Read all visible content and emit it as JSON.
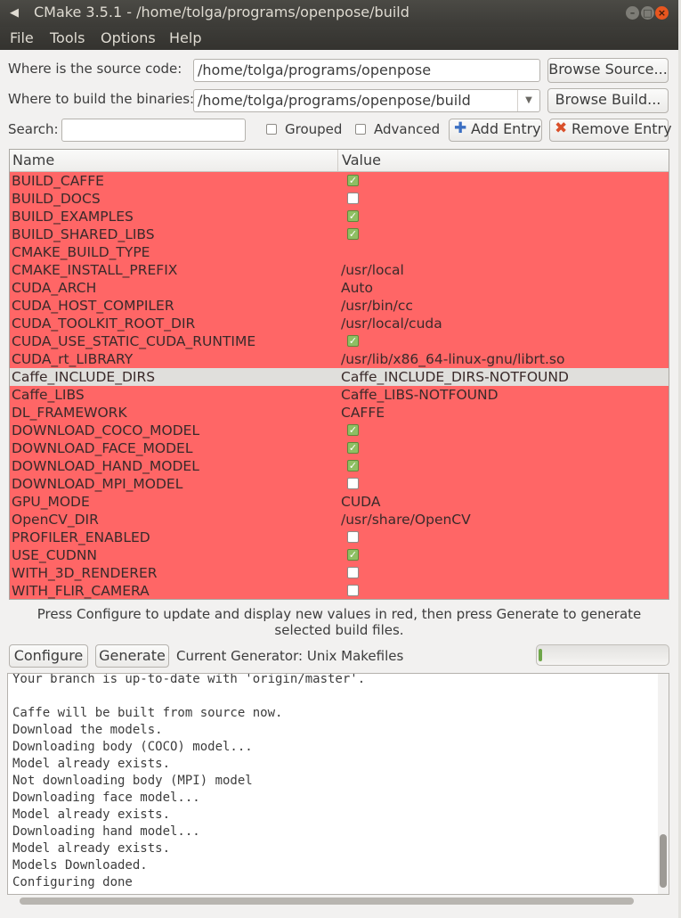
{
  "window": {
    "title": "CMake 3.5.1 - /home/tolga/programs/openpose/build"
  },
  "menu": [
    "File",
    "Tools",
    "Options",
    "Help"
  ],
  "source": {
    "label": "Where is the source code:",
    "value": "/home/tolga/programs/openpose",
    "browse_label": "Browse Source..."
  },
  "build": {
    "label": "Where to build the binaries:",
    "value": "/home/tolga/programs/openpose/build",
    "browse_label": "Browse Build..."
  },
  "search": {
    "label": "Search:",
    "value": "",
    "grouped_label": "Grouped",
    "advanced_label": "Advanced",
    "add_entry_label": "Add Entry",
    "remove_entry_label": "Remove Entry"
  },
  "table": {
    "headers": [
      "Name",
      "Value"
    ],
    "rows": [
      {
        "name": "BUILD_CAFFE",
        "type": "bool",
        "value": "true"
      },
      {
        "name": "BUILD_DOCS",
        "type": "bool",
        "value": "false"
      },
      {
        "name": "BUILD_EXAMPLES",
        "type": "bool",
        "value": "true"
      },
      {
        "name": "BUILD_SHARED_LIBS",
        "type": "bool",
        "value": "true"
      },
      {
        "name": "CMAKE_BUILD_TYPE",
        "type": "text",
        "value": ""
      },
      {
        "name": "CMAKE_INSTALL_PREFIX",
        "type": "text",
        "value": "/usr/local"
      },
      {
        "name": "CUDA_ARCH",
        "type": "text",
        "value": "Auto"
      },
      {
        "name": "CUDA_HOST_COMPILER",
        "type": "text",
        "value": "/usr/bin/cc"
      },
      {
        "name": "CUDA_TOOLKIT_ROOT_DIR",
        "type": "text",
        "value": "/usr/local/cuda"
      },
      {
        "name": "CUDA_USE_STATIC_CUDA_RUNTIME",
        "type": "bool",
        "value": "true"
      },
      {
        "name": "CUDA_rt_LIBRARY",
        "type": "text",
        "value": "/usr/lib/x86_64-linux-gnu/librt.so"
      },
      {
        "name": "Caffe_INCLUDE_DIRS",
        "type": "text",
        "value": "Caffe_INCLUDE_DIRS-NOTFOUND",
        "selected": true
      },
      {
        "name": "Caffe_LIBS",
        "type": "text",
        "value": "Caffe_LIBS-NOTFOUND"
      },
      {
        "name": "DL_FRAMEWORK",
        "type": "text",
        "value": "CAFFE"
      },
      {
        "name": "DOWNLOAD_COCO_MODEL",
        "type": "bool",
        "value": "true"
      },
      {
        "name": "DOWNLOAD_FACE_MODEL",
        "type": "bool",
        "value": "true"
      },
      {
        "name": "DOWNLOAD_HAND_MODEL",
        "type": "bool",
        "value": "true"
      },
      {
        "name": "DOWNLOAD_MPI_MODEL",
        "type": "bool",
        "value": "false"
      },
      {
        "name": "GPU_MODE",
        "type": "text",
        "value": "CUDA"
      },
      {
        "name": "OpenCV_DIR",
        "type": "text",
        "value": "/usr/share/OpenCV"
      },
      {
        "name": "PROFILER_ENABLED",
        "type": "bool",
        "value": "false"
      },
      {
        "name": "USE_CUDNN",
        "type": "bool",
        "value": "true"
      },
      {
        "name": "WITH_3D_RENDERER",
        "type": "bool",
        "value": "false"
      },
      {
        "name": "WITH_FLIR_CAMERA",
        "type": "bool",
        "value": "false"
      }
    ]
  },
  "hint": "Press Configure to update and display new values in red, then press Generate to generate selected build files.",
  "actions": {
    "configure_label": "Configure",
    "generate_label": "Generate",
    "generator_text": "Current Generator: Unix Makefiles"
  },
  "progress": {
    "fraction": 0.02
  },
  "output_lines": [
    "Your branch is up-to-date with 'origin/master'.",
    "",
    "Caffe will be built from source now.",
    "Download the models.",
    "Downloading body (COCO) model...",
    "Model already exists.",
    "Not downloading body (MPI) model",
    "Downloading face model...",
    "Model already exists.",
    "Downloading hand model...",
    "Model already exists.",
    "Models Downloaded.",
    "Configuring done"
  ],
  "colors": {
    "changed_row": "#ff6666",
    "selected_row": "#e0dfdc",
    "checkbox_on": "#8fbf63",
    "close_button": "#e8561f"
  },
  "icons": {
    "add": "plus-icon",
    "remove": "x-icon",
    "dropdown": "chevron-down-icon"
  }
}
